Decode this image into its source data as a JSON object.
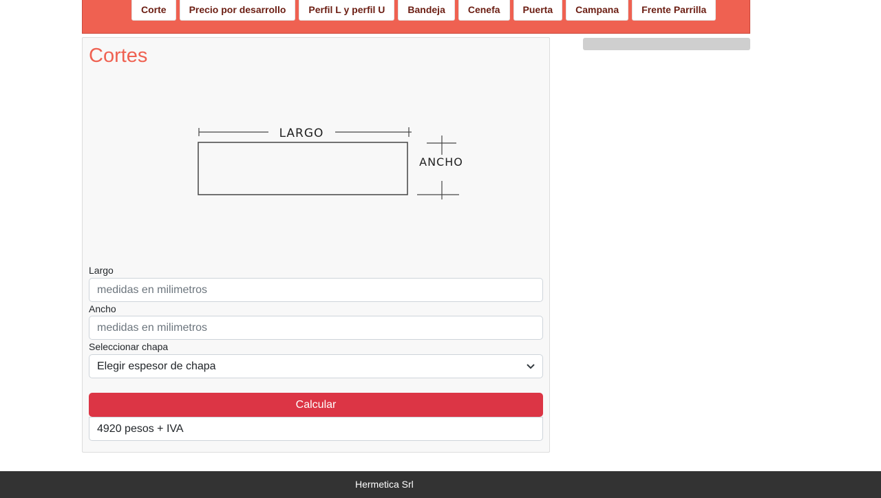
{
  "nav": {
    "items": [
      "Corte",
      "Precio por desarrollo",
      "Perfil L y perfil U",
      "Bandeja",
      "Cenefa",
      "Puerta",
      "Campana",
      "Frente Parrilla"
    ]
  },
  "card": {
    "title": "Cortes",
    "diagram": {
      "largo_label": "LARGO",
      "ancho_label": "ANCHO"
    },
    "largo": {
      "label": "Largo",
      "placeholder": "medidas en milimetros",
      "value": ""
    },
    "ancho": {
      "label": "Ancho",
      "placeholder": "medidas en milimetros",
      "value": ""
    },
    "chapa": {
      "label": "Seleccionar chapa",
      "selected": "Elegir espesor de chapa"
    },
    "calculate_label": "Calcular",
    "result": "4920 pesos + IVA"
  },
  "footer": {
    "text": "Hermetica Srl"
  },
  "colors": {
    "accent": "#ef6151",
    "button": "#dc3545",
    "footer": "#333333"
  }
}
